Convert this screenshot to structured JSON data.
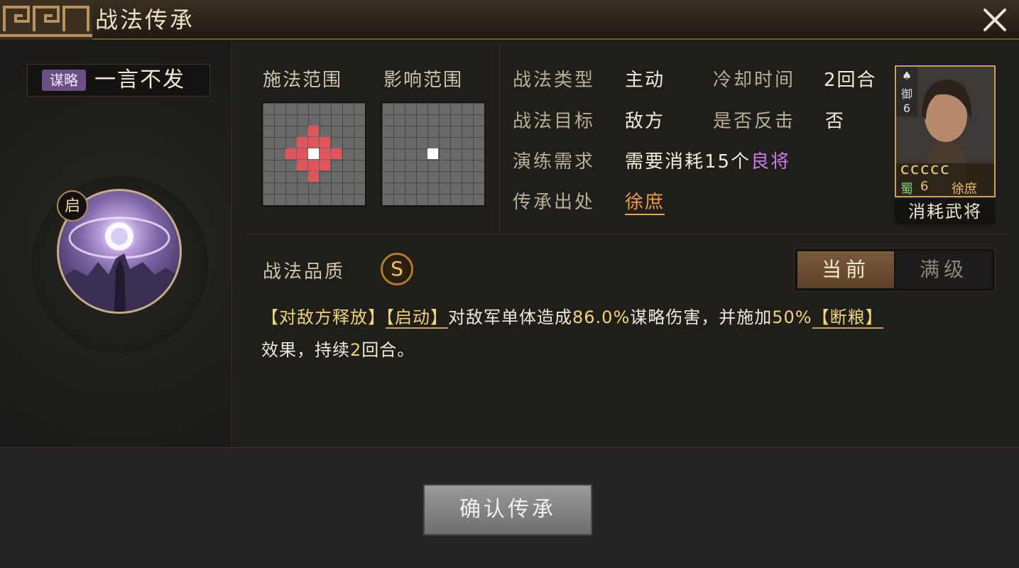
{
  "window": {
    "title": "战法传承",
    "close_icon": "close-icon"
  },
  "skill": {
    "tag": "谋略",
    "name": "一言不发",
    "badge": "启",
    "quality_label": "战法品质",
    "quality": "S"
  },
  "ranges": {
    "cast_label": "施法范围",
    "effect_label": "影响范围"
  },
  "info": {
    "type_label": "战法类型",
    "type_value": "主动",
    "cooldown_label": "冷却时间",
    "cooldown_value": "2回合",
    "target_label": "战法目标",
    "target_value": "敌方",
    "counter_label": "是否反击",
    "counter_value": "否",
    "train_label": "演练需求",
    "train_value_prefix": "需要消耗15个",
    "train_value_highlight": "良将",
    "source_label": "传承出处",
    "source_value": "徐庶"
  },
  "general": {
    "side_tag": "御",
    "side_number": "6",
    "faction": "蜀",
    "cost": "6",
    "name": "徐庶",
    "footer": "消耗武将",
    "rank_icons": "ccccc"
  },
  "tabs": {
    "current": "当前",
    "max": "满级"
  },
  "description": {
    "p1": "【对敌方释放】",
    "p2": "【启动】",
    "p3": "对敌军单体造成",
    "p4": "86.0%",
    "p5": "谋略伤害，并施加",
    "p6": "50%",
    "p7": "【断粮】",
    "p8": "效果，持续",
    "p9": "2",
    "p10": "回合。"
  },
  "actions": {
    "confirm": "确认传承"
  },
  "colors": {
    "accent_gold": "#c9a25a",
    "range_red": "#e0545a",
    "purple": "#c97be8",
    "orange": "#f0a034"
  }
}
